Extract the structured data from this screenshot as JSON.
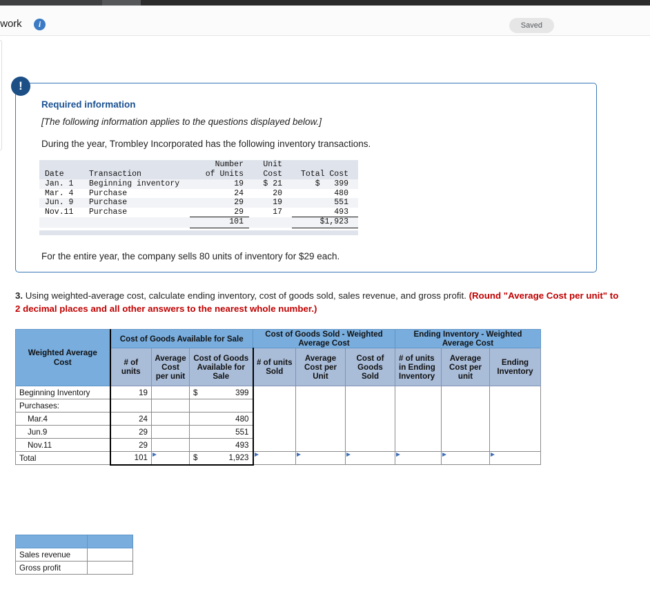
{
  "window": {
    "title": "ework",
    "info_icon": "info-icon",
    "saved_label": "Saved"
  },
  "required_info": {
    "alert_glyph": "!",
    "heading": "Required information",
    "italic_note": "[The following information applies to the questions displayed below.]",
    "intro": "During the year, Trombley Incorporated has the following inventory transactions.",
    "footer": "For the entire year, the company sells 80 units of inventory for $29 each."
  },
  "inventory_table": {
    "headers_top": [
      "",
      "",
      "Number",
      "Unit",
      ""
    ],
    "headers_bottom": [
      "Date",
      "Transaction",
      "of Units",
      "Cost",
      "Total Cost"
    ],
    "rows": [
      {
        "date": "Jan. 1",
        "transaction": "Beginning inventory",
        "units": "19",
        "unit_cost": "$ 21",
        "total_cost": "$   399"
      },
      {
        "date": "Mar. 4",
        "transaction": "Purchase",
        "units": "24",
        "unit_cost": "20",
        "total_cost": "480"
      },
      {
        "date": "Jun. 9",
        "transaction": "Purchase",
        "units": "29",
        "unit_cost": "19",
        "total_cost": "551"
      },
      {
        "date": "Nov.11",
        "transaction": "Purchase",
        "units": "29",
        "unit_cost": "17",
        "total_cost": "493"
      }
    ],
    "totals": {
      "units": "101",
      "unit_cost": "",
      "total_cost": "$1,923"
    }
  },
  "question": {
    "number": "3.",
    "text": " Using weighted-average cost, calculate ending inventory, cost of goods sold, sales revenue, and gross profit. ",
    "emphasis": "(Round \"Average Cost per unit\" to 2 decimal places and all other answers to the nearest whole number.)"
  },
  "answer_grid": {
    "corner_label": "Weighted Average Cost",
    "group_headers": [
      "Cost of Goods Available for Sale",
      "Cost of Goods Sold - Weighted Average Cost",
      "Ending Inventory - Weighted Average Cost"
    ],
    "sub_headers": [
      "# of units",
      "Average Cost per unit",
      "Cost of Goods Available for Sale",
      "# of units Sold",
      "Average Cost per Unit",
      "Cost of Goods Sold",
      "# of units in Ending Inventory",
      "Average Cost per unit",
      "Ending Inventory"
    ],
    "rows": [
      {
        "label": "Beginning Inventory",
        "indent": false,
        "units": "19",
        "avg_cost": "",
        "dollar": "$",
        "cogafs": "399"
      },
      {
        "label": "Purchases:",
        "indent": false,
        "units": "",
        "avg_cost": "",
        "dollar": "",
        "cogafs": ""
      },
      {
        "label": "Mar.4",
        "indent": true,
        "units": "24",
        "avg_cost": "",
        "dollar": "",
        "cogafs": "480"
      },
      {
        "label": "Jun.9",
        "indent": true,
        "units": "29",
        "avg_cost": "",
        "dollar": "",
        "cogafs": "551"
      },
      {
        "label": "Nov.11",
        "indent": true,
        "units": "29",
        "avg_cost": "",
        "dollar": "",
        "cogafs": "493"
      }
    ],
    "total_row": {
      "label": "Total",
      "units": "101",
      "avg_cost": "",
      "dollar": "$",
      "cogafs": "1,923"
    }
  },
  "summary_table": {
    "rows": [
      {
        "label": "Sales revenue",
        "value": ""
      },
      {
        "label": "Gross profit",
        "value": ""
      }
    ]
  },
  "colors": {
    "header_blue": "#78ADDE",
    "subheader_blue": "#A9BCD8",
    "accent_red": "#c00000",
    "link_blue": "#1a5192",
    "alert_navy": "#1b4f86"
  }
}
